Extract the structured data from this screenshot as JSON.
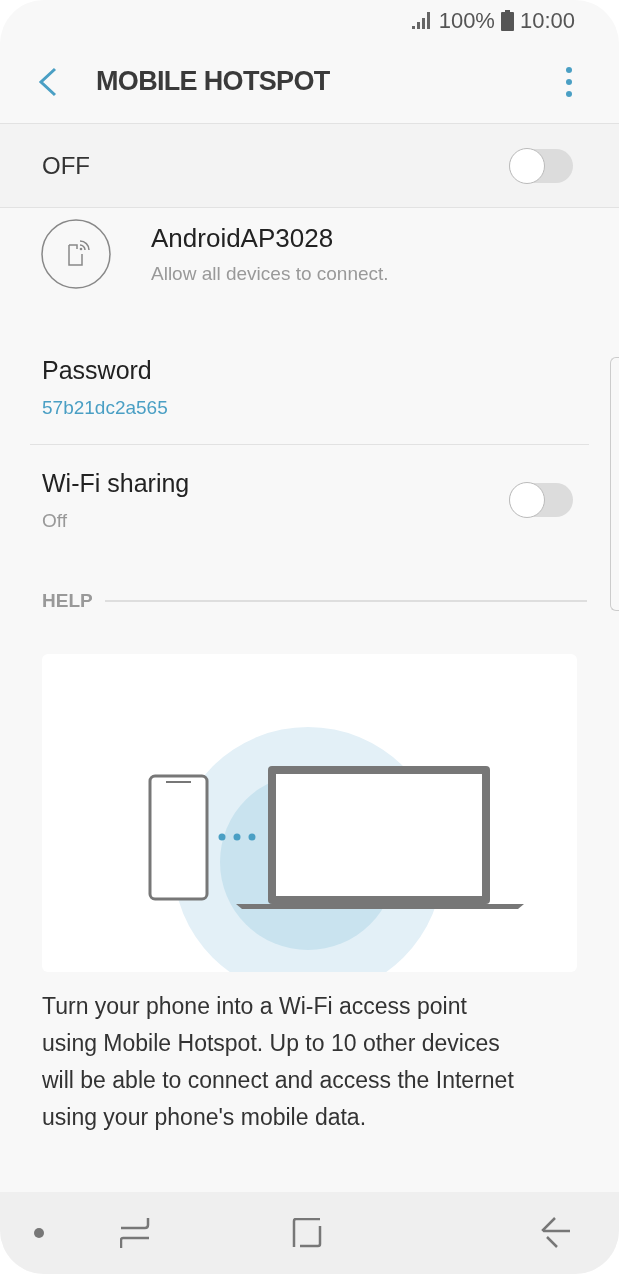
{
  "status_bar": {
    "battery": "100%",
    "time": "10:00"
  },
  "header": {
    "title": "MOBILE HOTSPOT"
  },
  "master_switch": {
    "label": "OFF",
    "on": false
  },
  "network": {
    "name": "AndroidAP3028",
    "subtitle": "Allow all devices to connect."
  },
  "password": {
    "label": "Password",
    "value": "57b21dc2a565"
  },
  "wifi_sharing": {
    "label": "Wi-Fi sharing",
    "value": "Off",
    "on": false
  },
  "help": {
    "heading": "HELP",
    "text": "Turn your phone into a Wi-Fi access point using Mobile Hotspot. Up to 10 other devices will be able to connect and access the Internet using your phone's mobile data."
  }
}
